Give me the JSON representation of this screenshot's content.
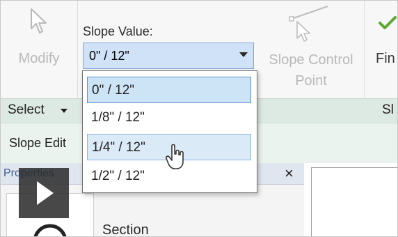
{
  "ribbon": {
    "modify_label": "Modify",
    "slope_value_label": "Slope Value:",
    "slope_value_selected": "0\" / 12\"",
    "slope_control_point_line1": "Slope Control",
    "slope_control_point_line2": "Point",
    "finish_label": "Fin"
  },
  "panels": {
    "select_label": "Select",
    "right_partial_label": "Sl"
  },
  "context_tab": {
    "label": "Slope Edit"
  },
  "properties": {
    "title": "Properties",
    "close_symbol": "×",
    "section_label": "Section"
  },
  "dropdown": {
    "options": [
      "0\" / 12\"",
      "1/8\" / 12\"",
      "1/4\" / 12\"",
      "1/2\" / 12\""
    ],
    "selected_index": 0,
    "hover_index": 2
  },
  "colors": {
    "selected_bg": "#cde3f6",
    "selected_border": "#5a8fd0",
    "hover_bg": "#dbeaf7",
    "panel_bar": "#dde9e3",
    "finish_check": "#5aa832"
  },
  "icons": [
    "arrow-pointer-icon",
    "slope-control-point-icon",
    "checkmark-icon",
    "play-icon",
    "mouse-cursor-icon",
    "dropdown-arrow-icon"
  ]
}
